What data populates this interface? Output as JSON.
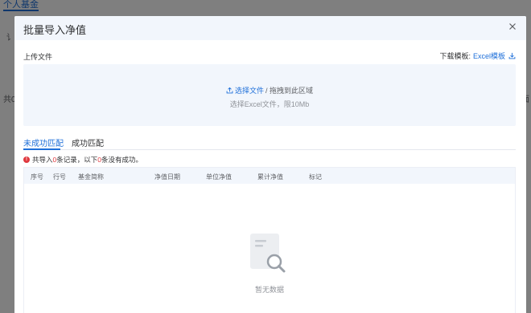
{
  "background": {
    "tab_label": "个人基金",
    "left_snippet_1": "讠",
    "left_snippet_2": "共0",
    "right_snippet_1": "i",
    "right_snippet_2": "面"
  },
  "modal": {
    "title": "批量导入净值",
    "upload_label": "上传文件",
    "template_prefix": "下载模板:",
    "template_link": "Excel模板",
    "dropzone": {
      "choose_label": "选择文件",
      "drag_label": "/ 拖拽到此区域",
      "hint": "选择Excel文件，限10Mb"
    },
    "tabs": [
      {
        "label": "未成功匹配",
        "active": true
      },
      {
        "label": "成功匹配",
        "active": false
      }
    ],
    "notice": {
      "part1": "共导入",
      "count_total": "0",
      "part2": "条记录，以下",
      "count_fail": "0",
      "part3": "条没有成功。"
    },
    "table": {
      "columns": [
        "序号",
        "行号",
        "基金简称",
        "净值日期",
        "单位净值",
        "累计净值",
        "标记"
      ],
      "rows": [],
      "empty_text": "暂无数据"
    }
  },
  "colors": {
    "accent": "#1e6fd9",
    "error": "#e0383e",
    "header_bg": "#f2f6fc"
  },
  "icons": [
    "close-icon",
    "download-icon",
    "upload-icon",
    "error-icon",
    "empty-data-icon"
  ]
}
